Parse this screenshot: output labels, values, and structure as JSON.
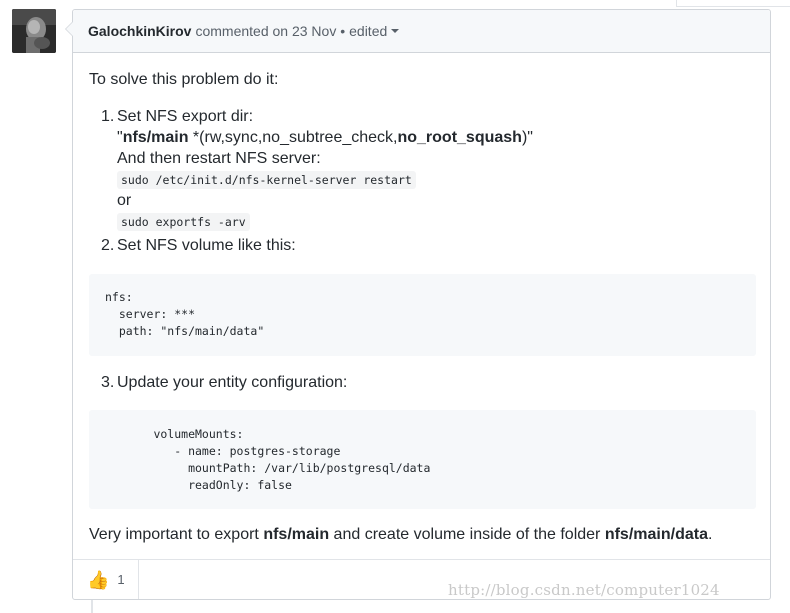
{
  "comment": {
    "author": "GalochkinKirov",
    "action": "commented on",
    "date": "23 Nov",
    "separator": "•",
    "edited_label": "edited",
    "intro": "To solve this problem do it:",
    "steps": [
      {
        "number": "1.",
        "title": "Set NFS export dir:",
        "export_quote_open": "\"",
        "export_path": "nfs/main",
        "export_opts_prefix": " *(rw,sync,no_subtree_check,",
        "export_opts_bold": "no_root_squash",
        "export_opts_suffix": ")\"",
        "restart_text": "And then restart NFS server:",
        "restart_cmd": "sudo /etc/init.d/nfs-kernel-server restart",
        "or_text": "or",
        "alt_cmd": "sudo exportfs -arv"
      },
      {
        "number": "2.",
        "title": "Set NFS volume like this:"
      },
      {
        "number": "3.",
        "title": "Update your entity configuration:"
      }
    ],
    "code_block_1": "nfs:\n  server: ***\n  path: \"nfs/main/data\"",
    "code_block_2": "       volumeMounts:\n          - name: postgres-storage\n            mountPath: /var/lib/postgresql/data\n            readOnly: false",
    "final": {
      "prefix": "Very important to export ",
      "bold1": "nfs/main",
      "middle": " and create volume inside of the folder ",
      "bold2": "nfs/main/data",
      "suffix": "."
    }
  },
  "reactions": {
    "thumbs_up_icon": "👍",
    "count": "1"
  },
  "watermark": "http://blog.csdn.net/computer1024"
}
